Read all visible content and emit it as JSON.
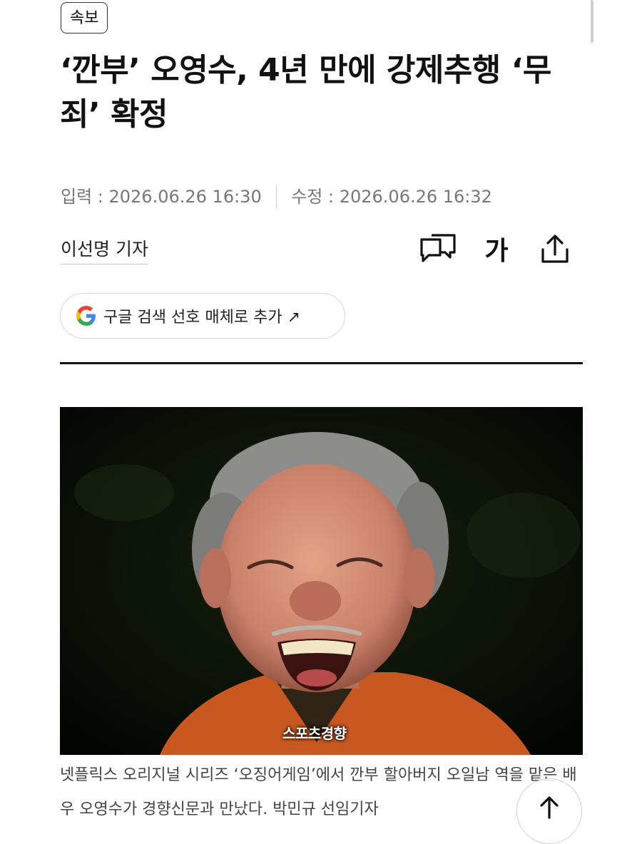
{
  "article": {
    "badge": "속보",
    "title": "‘깐부’ 오영수, 4년 만에 강제추행 ‘무죄’ 확정",
    "input_date": "입력 : 2026.06.26 16:30",
    "modified_date": "수정 : 2026.06.26 16:32",
    "reporter": "이선명 기자",
    "font_size_label": "가",
    "google_button_label": "구글 검색 선호 매체로 추가 ↗",
    "photo_watermark": "스포츠경향",
    "caption": "넷플릭스 오리지널 시리즈 ‘오징어게임’에서 깐부 할아버지 오일남 역을 맡은 배우 오영수가 경향신문과 만났다. 박민규 선임기자"
  },
  "icons": {
    "comment": "comment-icon",
    "share": "share-icon",
    "google": "google-logo-icon",
    "scroll_top": "arrow-up-icon"
  },
  "colors": {
    "text": "#111111",
    "meta": "#777777",
    "divider": "#111111",
    "jacket": "#c8581f"
  }
}
